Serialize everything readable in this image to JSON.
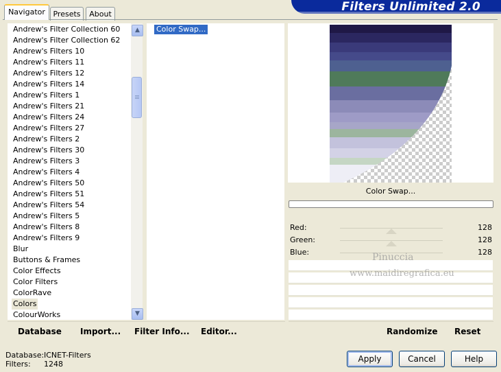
{
  "tabs": [
    {
      "label": "Navigator",
      "active": true
    },
    {
      "label": "Presets",
      "active": false
    },
    {
      "label": "About",
      "active": false
    }
  ],
  "banner": {
    "title": "Filters Unlimited 2.0"
  },
  "categories": [
    "Andrew's Filter Collection 60",
    "Andrew's Filter Collection 62",
    "Andrew's Filters 10",
    "Andrew's Filters 11",
    "Andrew's Filters 12",
    "Andrew's Filters 14",
    "Andrew's Filters 1",
    "Andrew's Filters 21",
    "Andrew's Filters 24",
    "Andrew's Filters 27",
    "Andrew's Filters 2",
    "Andrew's Filters 30",
    "Andrew's Filters 3",
    "Andrew's Filters 4",
    "Andrew's Filters 50",
    "Andrew's Filters 51",
    "Andrew's Filters 54",
    "Andrew's Filters 5",
    "Andrew's Filters 8",
    "Andrew's Filters 9",
    "Blur",
    "Buttons & Frames",
    "Color Effects",
    "Color Filters",
    "ColorRave",
    "Colors",
    "ColourWorks"
  ],
  "selected_category": "Colors",
  "filters": [
    "Color Swap..."
  ],
  "toolbar": {
    "database": "Database",
    "import": "Import...",
    "filter_info": "Filter Info...",
    "editor": "Editor...",
    "randomize": "Randomize",
    "reset": "Reset"
  },
  "filter_name": "Color Swap...",
  "controls": [
    {
      "label": "Red:",
      "value": "128"
    },
    {
      "label": "Green:",
      "value": "128"
    },
    {
      "label": "Blue:",
      "value": "128"
    }
  ],
  "status": {
    "database_label": "Database:",
    "database_value": "ICNET-Filters",
    "filters_label": "Filters:",
    "filters_value": "1248"
  },
  "buttons": {
    "apply": "Apply",
    "cancel": "Cancel",
    "help": "Help"
  },
  "watermark": {
    "line1": "Pinuccia",
    "line2": "www.maidiregrafica.eu"
  },
  "colors": {
    "accent": "#316ac5",
    "banner": "#0a2a9c",
    "panel_bg": "#ece9d8"
  }
}
